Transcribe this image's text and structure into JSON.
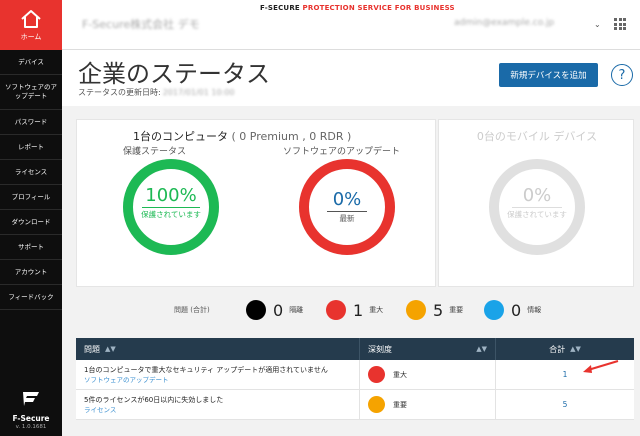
{
  "sidebar": {
    "home_label": "ホーム",
    "items": [
      {
        "label": "デバイス"
      },
      {
        "label": "ソフトウェアのアップデート"
      },
      {
        "label": "パスワード"
      },
      {
        "label": "レポート"
      },
      {
        "label": "ライセンス"
      },
      {
        "label": "プロフィール"
      },
      {
        "label": "ダウンロード"
      },
      {
        "label": "サポート"
      },
      {
        "label": "アカウント"
      },
      {
        "label": "フィードバック"
      }
    ],
    "brand": "F-Secure",
    "version": "v. 1.0.1681"
  },
  "topbar": {
    "company": "F-Secure株式会社 デモ",
    "service_brand": "F-SECURE",
    "service_name": "PROTECTION SERVICE FOR BUSINESS",
    "user": "admin@example.co.jp"
  },
  "header": {
    "title": "企業のステータス",
    "updated_label": "ステータスの更新日時:",
    "updated_value": "2017/01/01 10:00",
    "add_device_button": "新規デバイスを追加",
    "help_label": "?"
  },
  "computers": {
    "title_main": "1台のコンピュータ",
    "title_sub": "( 0 Premium , 0 RDR )",
    "protection": {
      "label": "保護ステータス",
      "percent": "100%",
      "sub": "保護されています",
      "fraction": 1.0,
      "color": "#1db954"
    },
    "updates": {
      "label": "ソフトウェアのアップデート",
      "percent": "0%",
      "sub": "最新",
      "fraction": 0.0,
      "color": "#e8332e"
    }
  },
  "mobile": {
    "title": "0台のモバイル デバイス",
    "percent": "0%",
    "sub": "保護されています"
  },
  "issues": {
    "label": "問題 (合計)",
    "items": [
      {
        "count": "0",
        "name": "隔離",
        "color": "#000000"
      },
      {
        "count": "1",
        "name": "重大",
        "color": "#e8332e"
      },
      {
        "count": "5",
        "name": "重要",
        "color": "#f5a300"
      },
      {
        "count": "0",
        "name": "情報",
        "color": "#1aa3e8"
      }
    ]
  },
  "table": {
    "headers": [
      "問題",
      "深刻度",
      "合計"
    ],
    "rows": [
      {
        "title": "1台のコンピュータで重大なセキュリティ アップデートが適用されていません",
        "category": "ソフトウェアのアップデート",
        "severity": "重大",
        "severity_color": "#e8332e",
        "total": "1"
      },
      {
        "title": "5件のライセンスが60日以内に失効しました",
        "category": "ライセンス",
        "severity": "重要",
        "severity_color": "#f5a300",
        "total": "5"
      }
    ]
  }
}
